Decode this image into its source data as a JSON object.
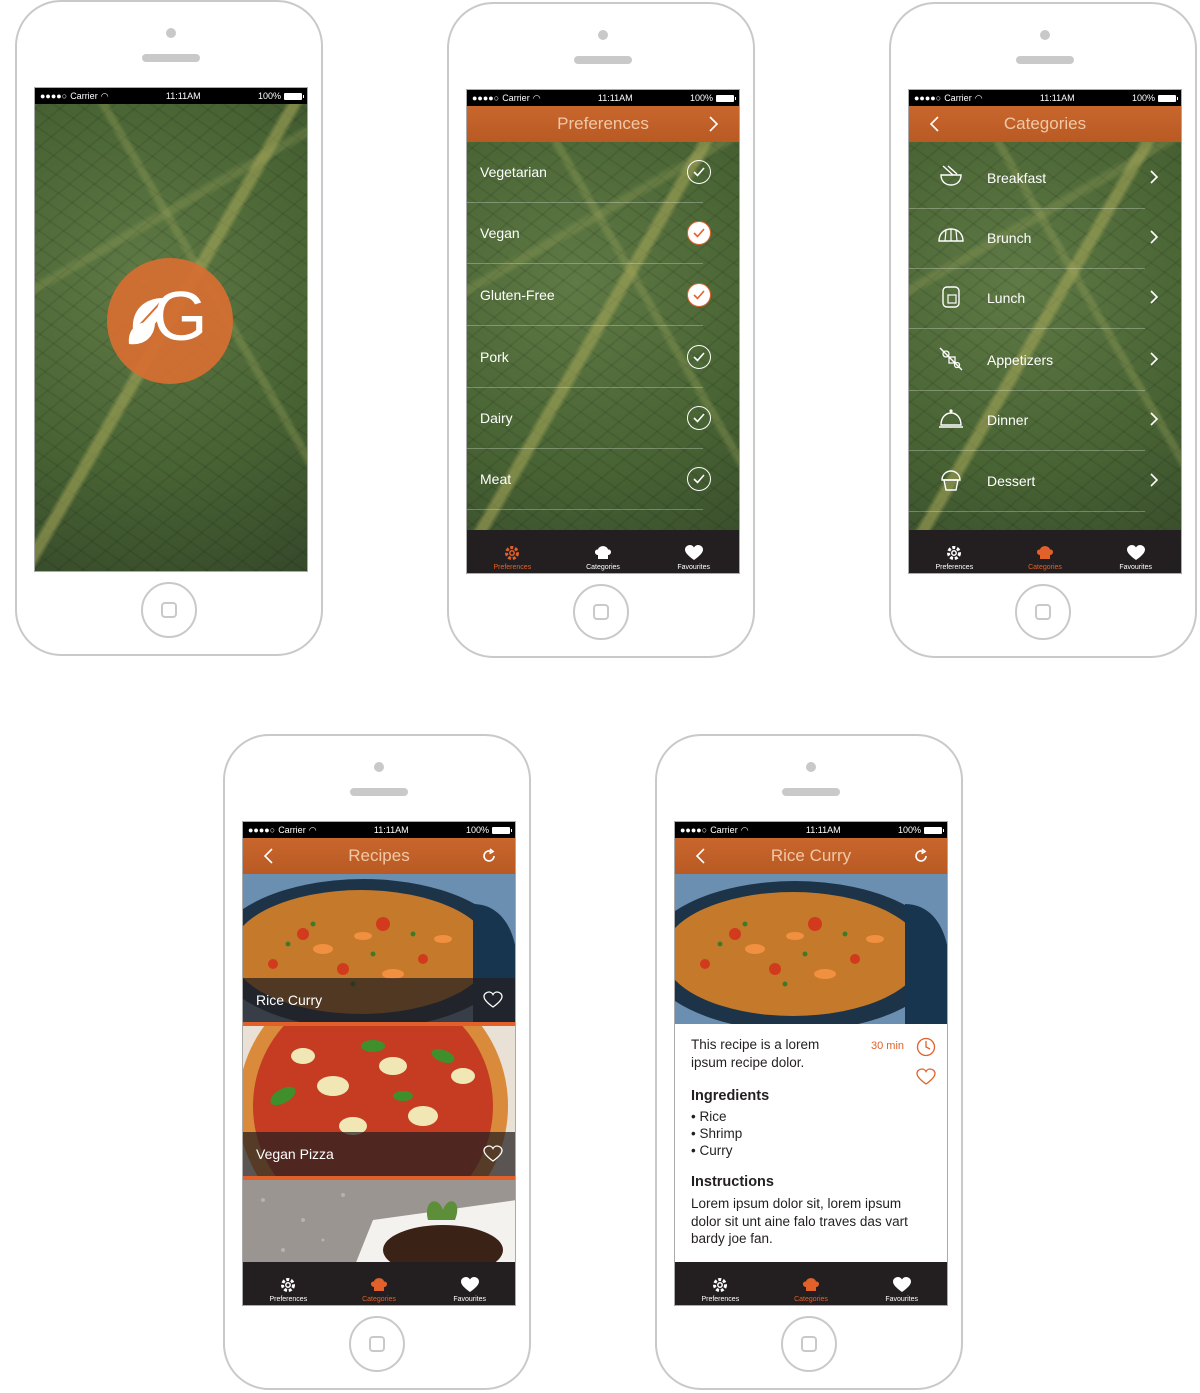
{
  "status": {
    "carrier": "Carrier",
    "time": "11:11AM",
    "battery": "100%"
  },
  "splash": {
    "logo_letter": "G"
  },
  "preferences": {
    "title": "Preferences",
    "items": [
      {
        "label": "Vegetarian",
        "checked": false
      },
      {
        "label": "Vegan",
        "checked": true
      },
      {
        "label": "Gluten-Free",
        "checked": true
      },
      {
        "label": "Pork",
        "checked": false
      },
      {
        "label": "Dairy",
        "checked": false
      },
      {
        "label": "Meat",
        "checked": false
      }
    ]
  },
  "categories": {
    "title": "Categories",
    "items": [
      {
        "label": "Breakfast",
        "icon": "bowl-icon"
      },
      {
        "label": "Brunch",
        "icon": "croissant-icon"
      },
      {
        "label": "Lunch",
        "icon": "sandwich-icon"
      },
      {
        "label": "Appetizers",
        "icon": "skewer-icon"
      },
      {
        "label": "Dinner",
        "icon": "cloche-icon"
      },
      {
        "label": "Dessert",
        "icon": "cupcake-icon"
      }
    ]
  },
  "recipes": {
    "title": "Recipes",
    "items": [
      {
        "label": "Rice Curry"
      },
      {
        "label": "Vegan Pizza"
      }
    ]
  },
  "detail": {
    "title": "Rice Curry",
    "description": "This recipe is a lorem ipsum recipe dolor.",
    "time": "30 min",
    "ingredients_heading": "Ingredients",
    "ingredients": [
      "• Rice",
      "• Shrimp",
      "• Curry"
    ],
    "instructions_heading": "Instructions",
    "instructions": "Lorem ipsum dolor sit, lorem ipsum dolor sit unt aine falo traves das vart bardy joe fan."
  },
  "tabs": {
    "preferences": "Preferences",
    "categories": "Categories",
    "favourites": "Favourites"
  },
  "colors": {
    "accent": "#e2612a",
    "tabbar": "#231f20",
    "leaf": "#4b6637"
  }
}
